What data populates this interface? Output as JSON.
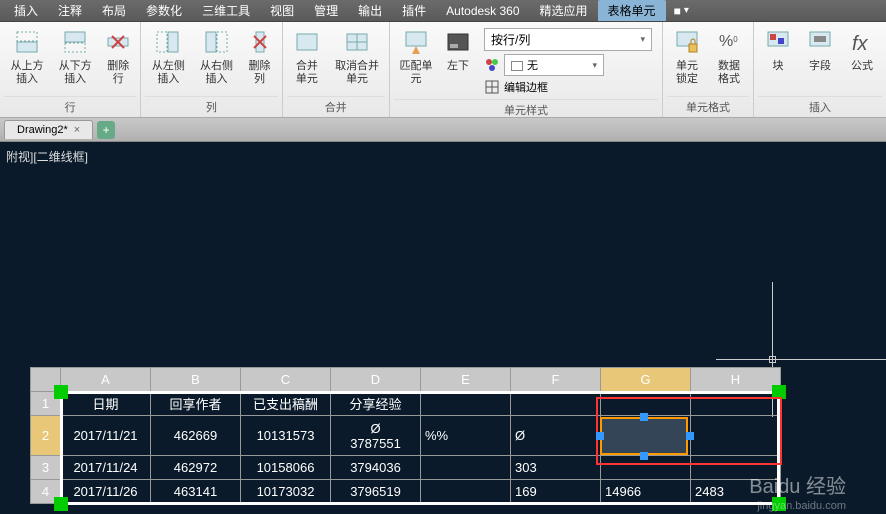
{
  "menubar": {
    "items": [
      "插入",
      "注释",
      "布局",
      "参数化",
      "三维工具",
      "视图",
      "管理",
      "输出",
      "插件",
      "Autodesk 360",
      "精选应用",
      "表格单元"
    ],
    "active_index": 11,
    "dropdown_icon": "■▾"
  },
  "ribbon": {
    "groups": [
      {
        "label": "行",
        "buttons": [
          {
            "label": "从上方\n插入",
            "icon": "row-insert-above"
          },
          {
            "label": "从下方\n插入",
            "icon": "row-insert-below"
          },
          {
            "label": "删除\n行",
            "icon": "row-delete"
          }
        ]
      },
      {
        "label": "列",
        "buttons": [
          {
            "label": "从左侧\n插入",
            "icon": "col-insert-left"
          },
          {
            "label": "从右侧\n插入",
            "icon": "col-insert-right"
          },
          {
            "label": "删除\n列",
            "icon": "col-delete"
          }
        ]
      },
      {
        "label": "合并",
        "buttons": [
          {
            "label": "合并\n单元",
            "icon": "merge-cells"
          },
          {
            "label": "取消合并\n单元",
            "icon": "unmerge-cells"
          }
        ]
      },
      {
        "label": "单元样式",
        "buttons": [
          {
            "label": "匹配单元",
            "icon": "match-cell"
          },
          {
            "label": "左下",
            "icon": "align-bottom-left"
          }
        ],
        "dropdowns": [
          {
            "label": "按行/列",
            "key": "row_col"
          },
          {
            "label": "无",
            "key": "none",
            "prefix_icon": "bgcolor"
          },
          {
            "label": "编辑边框",
            "key": "edit_border",
            "prefix_icon": "border"
          }
        ]
      },
      {
        "label": "单元格式",
        "buttons": [
          {
            "label": "单元锁定",
            "icon": "cell-lock"
          },
          {
            "label": "数据格式",
            "icon": "data-format"
          }
        ]
      },
      {
        "label": "插入",
        "buttons": [
          {
            "label": "块",
            "icon": "block"
          },
          {
            "label": "字段",
            "icon": "field"
          },
          {
            "label": "公式",
            "icon": "formula"
          }
        ]
      }
    ]
  },
  "tabs": {
    "doc_name": "Drawing2*",
    "close": "×",
    "add": "+"
  },
  "canvas": {
    "view_label": "附视][二维线框]"
  },
  "chart_data": {
    "type": "table",
    "columns": [
      "A",
      "B",
      "C",
      "D",
      "E",
      "F",
      "G",
      "H"
    ],
    "selected_column_index": 6,
    "row_numbers": [
      1,
      2,
      3,
      4
    ],
    "selected_row_index": 1,
    "headers": [
      "日期",
      "回享作者",
      "已支出稿酬",
      "分享经验",
      "",
      "",
      "",
      ""
    ],
    "rows": [
      [
        "2017/11/21",
        "462669",
        "10131573",
        "Ø\n3787551",
        "%%",
        "Ø",
        "",
        ""
      ],
      [
        "2017/11/24",
        "462972",
        "10158066",
        "3794036",
        "",
        "303",
        "",
        ""
      ],
      [
        "2017/11/26",
        "463141",
        "10173032",
        "3796519",
        "",
        "169",
        "14966",
        "2483"
      ]
    ],
    "selected_cell": {
      "row": 2,
      "col": "G"
    }
  },
  "watermark": {
    "main": "Baidu 经验",
    "sub": "jingyan.baidu.com"
  }
}
